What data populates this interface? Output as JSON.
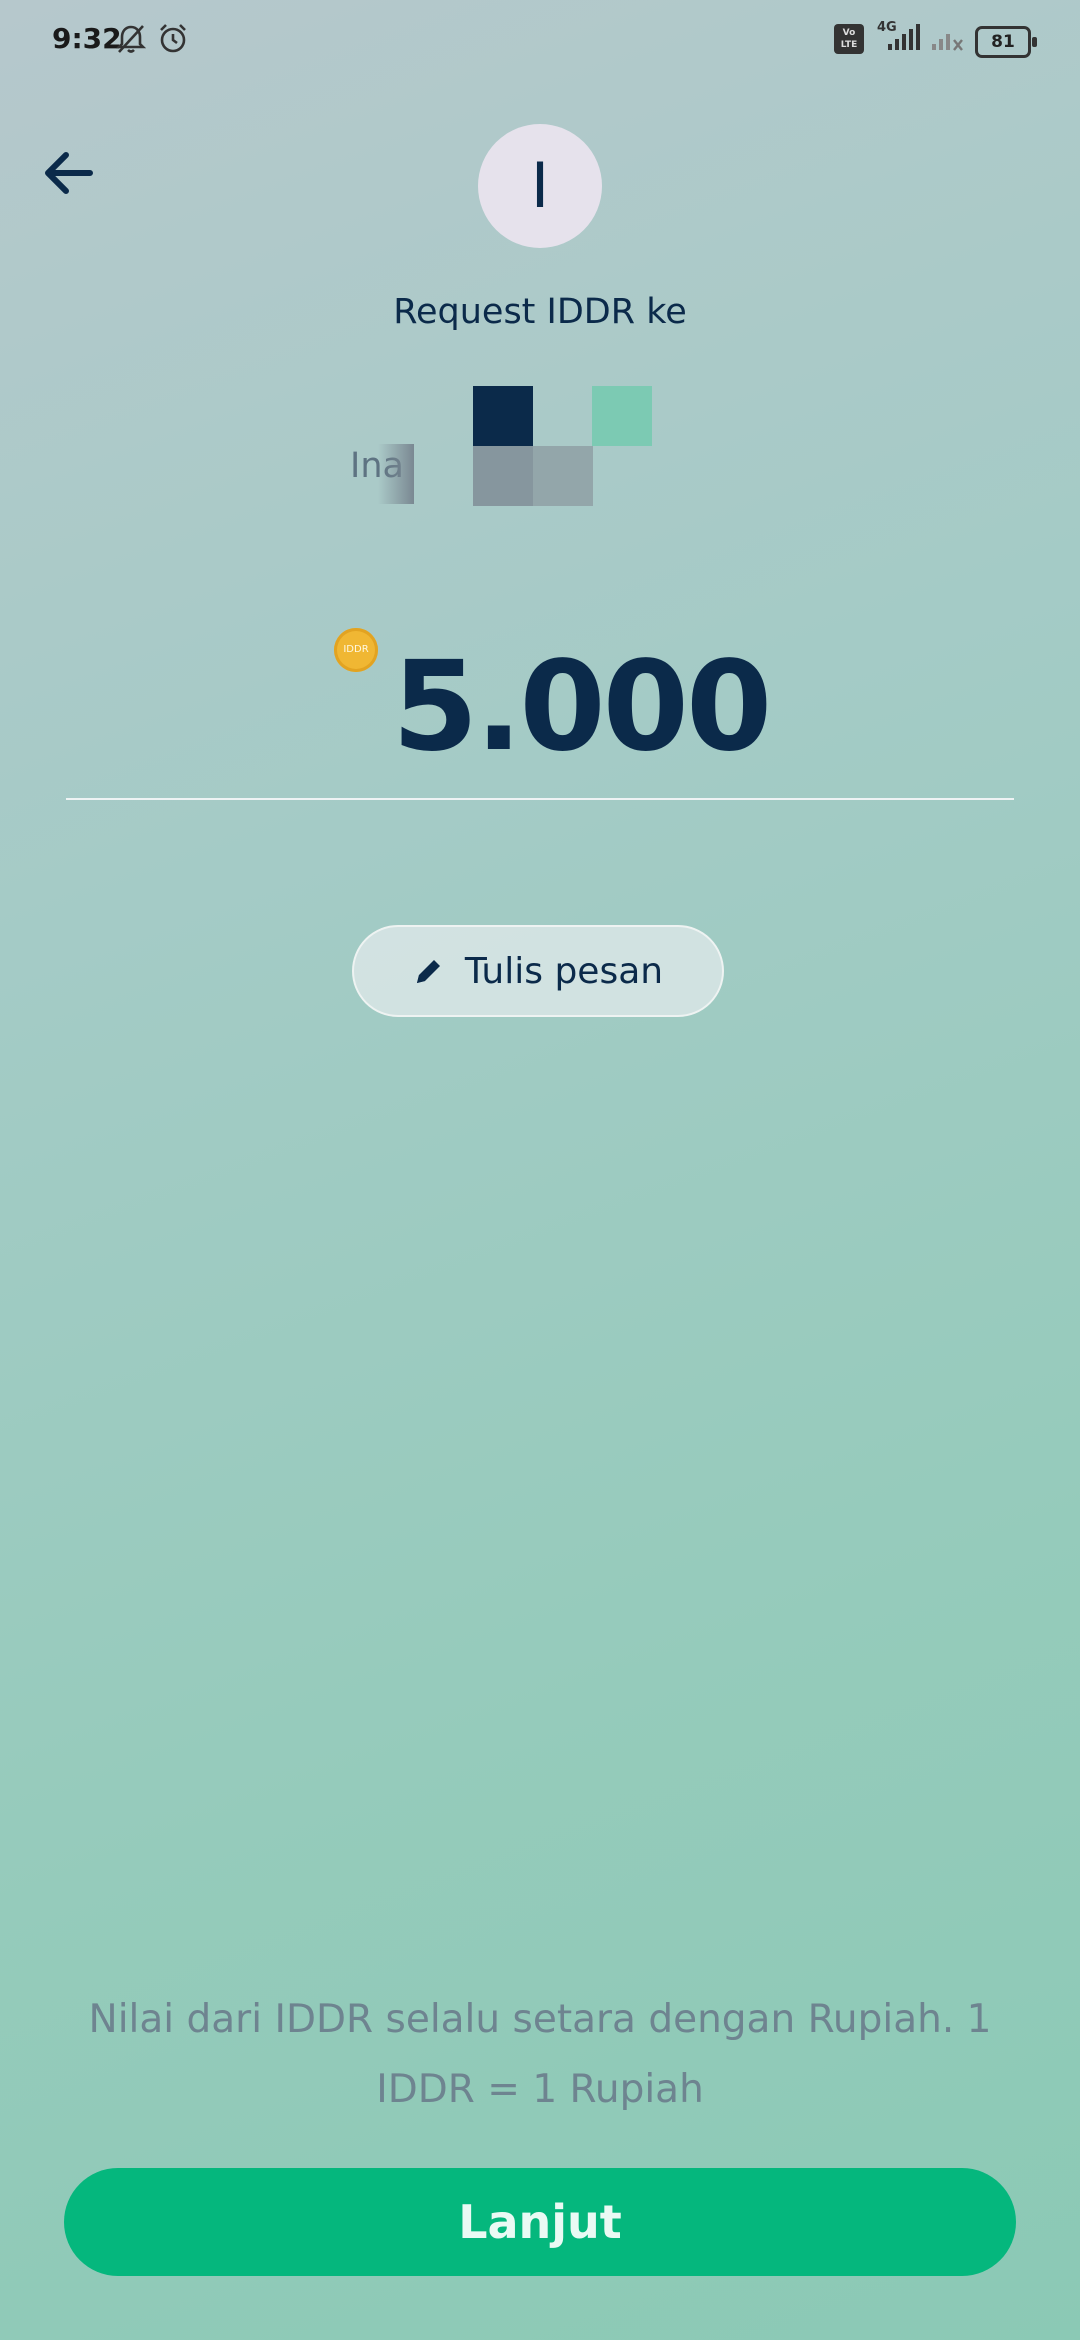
{
  "status_bar": {
    "time": "9:32",
    "battery": "81",
    "network": "4G",
    "volte": "Vo LTE",
    "icons": [
      "mute-icon",
      "alarm-icon",
      "volte-icon",
      "signal-icon",
      "signal-off-icon",
      "battery-icon"
    ]
  },
  "header": {
    "back_icon": "arrow-left-icon",
    "avatar_initial": "I",
    "request_title": "Request IDDR ke",
    "recipient_name": "Ina"
  },
  "amount": {
    "coin_label": "IDDR",
    "value": "5.000"
  },
  "message_button": {
    "icon": "pencil-icon",
    "label": "Tulis pesan"
  },
  "info_text": "Nilai dari IDDR selalu setara dengan Rupiah. 1 IDDR = 1 Rupiah",
  "next_button": {
    "label": "Lanjut"
  },
  "colors": {
    "primary_text": "#0b2a4a",
    "accent_green": "#05b77d",
    "coin_gold": "#f0b733",
    "muted_text": "#6e8490"
  }
}
